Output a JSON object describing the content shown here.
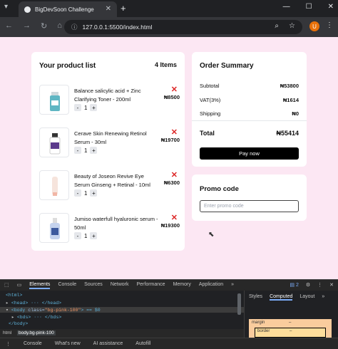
{
  "browser": {
    "tab_title": "BigDevSoon Challenge",
    "url": "127.0.0.1:5500/index.html",
    "profile_initial": "U"
  },
  "product_list": {
    "title": "Your product list",
    "count_label": "4 Items",
    "items": [
      {
        "name": "Balance salicylic acid + Zinc Clarifying Toner - 200ml",
        "qty": "1",
        "price": "₦8500",
        "image_color": "#5fb6c3"
      },
      {
        "name": "Cerave Skin Renewing Retinol Serum - 30ml",
        "qty": "1",
        "price": "₦19700",
        "image_color": "#5b3a8c"
      },
      {
        "name": "Beauty of Joseon Revive Eye Serum Ginseng + Retinal - 10ml",
        "qty": "1",
        "price": "₦6300",
        "image_color": "#f1b6a6"
      },
      {
        "name": "Jumiso waterfull hyaluronic serum - 50ml",
        "qty": "1",
        "price": "₦19300",
        "image_color": "#3d5a9e"
      }
    ],
    "minus_label": "-",
    "plus_label": "+",
    "remove_label": "✕"
  },
  "order_summary": {
    "title": "Order Summary",
    "rows": [
      {
        "label": "Subtotal",
        "value": "₦53800"
      },
      {
        "label": "VAT(3%)",
        "value": "₦1614"
      },
      {
        "label": "Shipping",
        "value": "₦0"
      }
    ],
    "total_label": "Total",
    "total_value": "₦55414",
    "pay_button": "Pay now"
  },
  "promo": {
    "title": "Promo code",
    "placeholder": "Enter promo code"
  },
  "devtools": {
    "tabs": [
      "Elements",
      "Console",
      "Sources",
      "Network",
      "Performance",
      "Memory",
      "Application",
      "»"
    ],
    "issues_badge": "2",
    "dom": {
      "html": "<html>",
      "head": "<head> ··· </head>",
      "body_open": "<body ",
      "body_attr": "class=",
      "body_val": "\"bg-pink-100\"",
      "body_rest": "> == $0",
      "bds": "<bds> ··· </bds>",
      "body_close": "</body>"
    },
    "breadcrumbs": [
      "html",
      "body.bg-pink-100"
    ],
    "side_tabs": [
      "Styles",
      "Computed",
      "Layout",
      "»"
    ],
    "box_margin": "margin",
    "box_border": "border",
    "box_dash": "–",
    "drawer_tabs": [
      "Console",
      "What's new",
      "AI assistance",
      "Autofill"
    ]
  }
}
